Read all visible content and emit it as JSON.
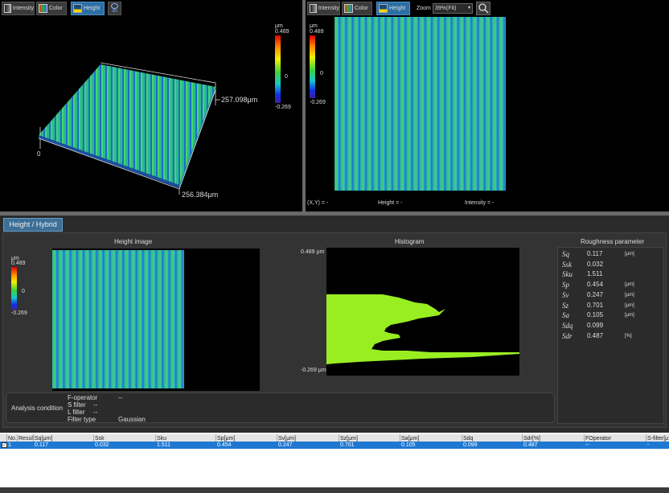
{
  "toolbar_left": {
    "intensity": "Intensity",
    "color": "Color",
    "height": "Height",
    "view3d": "3D"
  },
  "toolbar_right": {
    "intensity": "Intensity",
    "color": "Color",
    "height": "Height",
    "zoom_label": "Zoom",
    "zoom_value": "39%(Fit)"
  },
  "view3d": {
    "unit": "μm",
    "max": "0.489",
    "zero": "0",
    "min": "-0.269",
    "y_extent": "257.098μm",
    "x_extent": "256.384μm",
    "origin": "0"
  },
  "view2d": {
    "unit": "μm",
    "max": "0.489",
    "zero": "0",
    "min": "-0.269",
    "xy_label": "(X,Y) = -",
    "height_label": "Height = -",
    "intensity_label": "Intensity = -"
  },
  "tab": "Height / Hybrid",
  "height_image": {
    "title": "Height image",
    "unit": "μm",
    "max": "0.489",
    "zero": "0",
    "min": "-0.269"
  },
  "histogram": {
    "title": "Histogram",
    "top": "0.489 μm",
    "bottom": "-0.269 μm",
    "fill": "#99ee22"
  },
  "roughness": {
    "title": "Roughness parameter",
    "rows": [
      {
        "name": "Sq",
        "value": "0.117",
        "unit": "[μm]"
      },
      {
        "name": "Ssk",
        "value": "0.032",
        "unit": ""
      },
      {
        "name": "Sku",
        "value": "1.511",
        "unit": ""
      },
      {
        "name": "Sp",
        "value": "0.454",
        "unit": "[μm]"
      },
      {
        "name": "Sv",
        "value": "0.247",
        "unit": "[μm]"
      },
      {
        "name": "Sz",
        "value": "0.701",
        "unit": "[μm]"
      },
      {
        "name": "Sa",
        "value": "0.105",
        "unit": "[μm]"
      },
      {
        "name": "Sdq",
        "value": "0.099",
        "unit": ""
      },
      {
        "name": "Sdr",
        "value": "0.487",
        "unit": "[%]"
      }
    ]
  },
  "analysis": {
    "label": "Analysis condition",
    "f_operator_label": "F-operator",
    "f_operator_value": "--",
    "s_filter_label": "S filter",
    "s_filter_value": "--",
    "l_filter_label": "L filter",
    "l_filter_value": "--",
    "filter_type_label": "Filter type",
    "filter_type_value": "Gaussian"
  },
  "results": {
    "headers": [
      "No.",
      "Result",
      "Sq[μm]",
      "Ssk",
      "Sku",
      "Sp[μm]",
      "Sv[μm]",
      "Sz[μm]",
      "Sa[μm]",
      "Sdq",
      "Sdr[%]",
      "FOperator",
      "S-filter[μ"
    ],
    "row": [
      "1",
      "",
      "0.117",
      "0.032",
      "1.511",
      "0.454",
      "0.247",
      "0.701",
      "0.105",
      "0.099",
      "0.487",
      "--",
      "-"
    ]
  },
  "colors": {
    "accent": "#2d6fa5",
    "selection": "#1e78d2",
    "background": "#1e1e1e"
  }
}
